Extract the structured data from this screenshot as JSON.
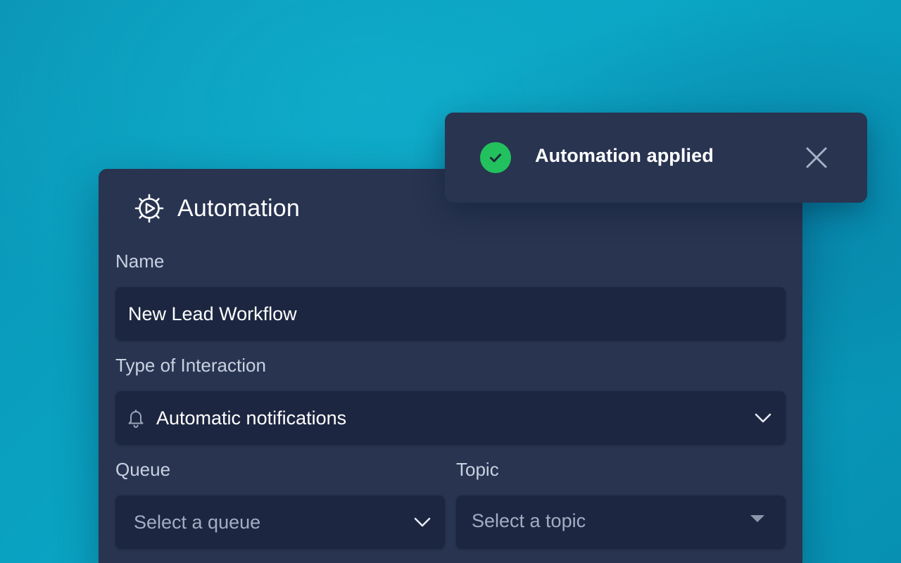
{
  "card": {
    "title": "Automation",
    "icon": "gear-play-icon"
  },
  "form": {
    "name": {
      "label": "Name",
      "value": "New Lead Workflow"
    },
    "interaction_type": {
      "label": "Type of Interaction",
      "value": "Automatic notifications",
      "icon": "bell-icon"
    },
    "queue": {
      "label": "Queue",
      "placeholder": "Select a queue"
    },
    "topic": {
      "label": "Topic",
      "placeholder": "Select a topic"
    }
  },
  "toast": {
    "message": "Automation applied",
    "status": "success",
    "status_color": "#22c15e",
    "icon": "check-circle-icon",
    "close_icon": "close-icon"
  },
  "colors": {
    "panel": "#283450",
    "input": "#1c2640",
    "background": "#0aa4c3"
  }
}
